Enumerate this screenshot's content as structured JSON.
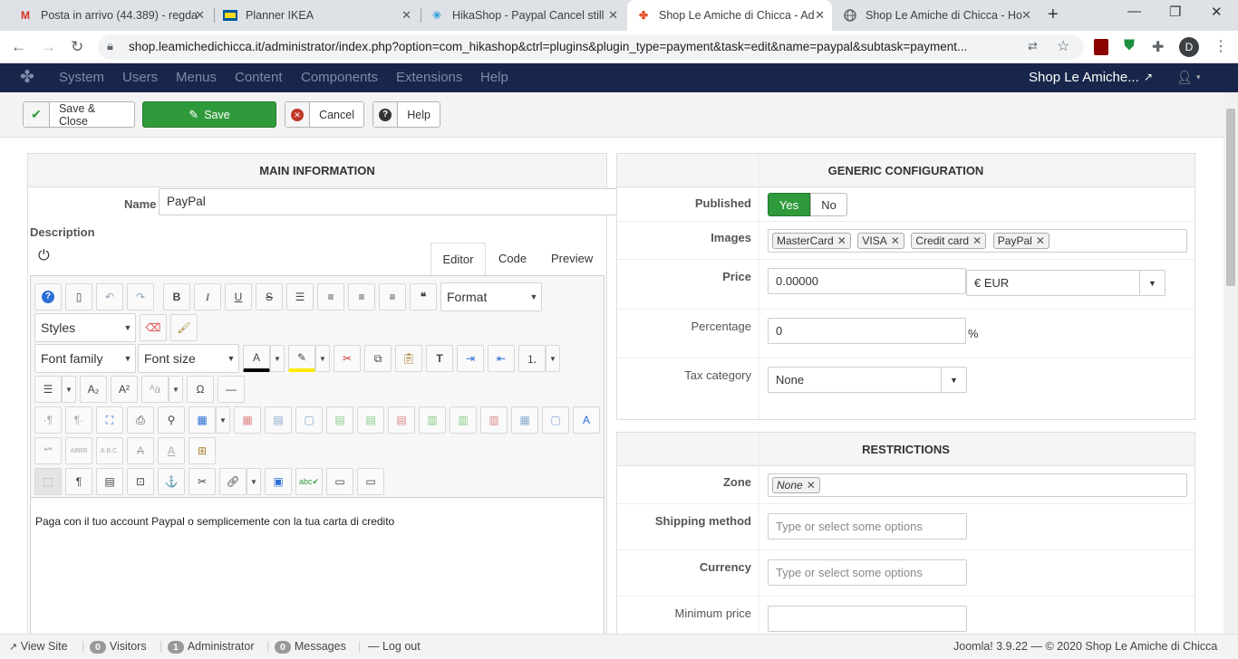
{
  "browser": {
    "tabs": [
      {
        "title": "Posta in arrivo (44.389) - regda",
        "icon": "gmail-icon"
      },
      {
        "title": "Planner IKEA",
        "icon": "ikea-icon"
      },
      {
        "title": "HikaShop - Paypal Cancel still",
        "icon": "hikashop-icon"
      },
      {
        "title": "Shop Le Amiche di Chicca - Ad",
        "icon": "joomla-icon"
      },
      {
        "title": "Shop Le Amiche di Chicca - Ho",
        "icon": "globe-icon"
      }
    ],
    "url": "shop.leamichedichicca.it/administrator/index.php?option=com_hikashop&ctrl=plugins&plugin_type=payment&task=edit&name=paypal&subtask=payment...",
    "profile_initial": "D"
  },
  "joomla_nav": {
    "menu": [
      "System",
      "Users",
      "Menus",
      "Content",
      "Components",
      "Extensions",
      "Help"
    ],
    "site_name": "Shop Le Amiche..."
  },
  "toolbar": {
    "save_close": "Save & Close",
    "save": "Save",
    "cancel": "Cancel",
    "help": "Help"
  },
  "main_info": {
    "heading": "MAIN INFORMATION",
    "name_label": "Name",
    "name_value": "PayPal",
    "description_label": "Description",
    "editor_tabs": [
      "Editor",
      "Code",
      "Preview"
    ],
    "format_select": "Format",
    "styles_select": "Styles",
    "font_family_select": "Font family",
    "font_size_select": "Font size",
    "content": "Paga con il tuo account Paypal o semplicemente con la tua carta di credito"
  },
  "generic_config": {
    "heading": "GENERIC CONFIGURATION",
    "published_label": "Published",
    "published_yes": "Yes",
    "published_no": "No",
    "images_label": "Images",
    "images": [
      "MasterCard",
      "VISA",
      "Credit card",
      "PayPal"
    ],
    "price_label": "Price",
    "price_value": "0.00000",
    "currency_value": "€ EUR",
    "percentage_label": "Percentage",
    "percentage_value": "0",
    "percent_sign": "%",
    "tax_label": "Tax category",
    "tax_value": "None"
  },
  "restrictions": {
    "heading": "RESTRICTIONS",
    "zone_label": "Zone",
    "zone_value": "None",
    "shipping_label": "Shipping method",
    "shipping_placeholder": "Type or select some options",
    "currency_label": "Currency",
    "currency_placeholder": "Type or select some options",
    "min_price_label": "Minimum price"
  },
  "status_bar": {
    "view_site": "View Site",
    "visitors_count": "0",
    "visitors": "Visitors",
    "admin_count": "1",
    "admin": "Administrator",
    "messages_count": "0",
    "messages": "Messages",
    "logout": "Log out",
    "footer": "Joomla! 3.9.22  —  © 2020 Shop Le Amiche di Chicca"
  },
  "colors": {
    "joomla_nav_bg": "#17264a",
    "save_green": "#2f9a3b",
    "cancel_red": "#c0392b"
  }
}
